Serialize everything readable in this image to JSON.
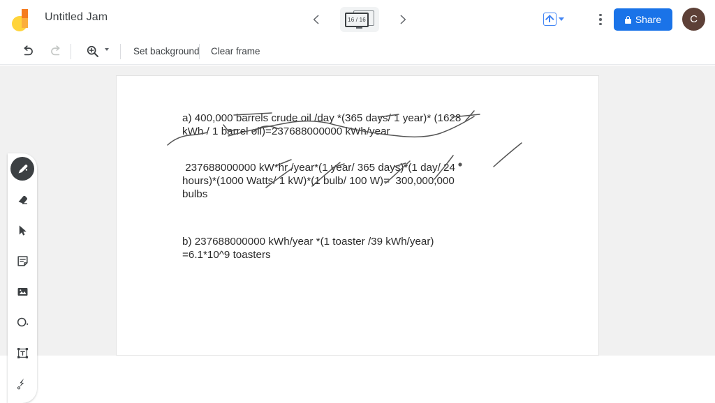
{
  "app": {
    "logo_icon": "jamboard-logo-icon",
    "title": "Untitled Jam"
  },
  "topbar": {
    "prev_frame_icon": "chevron-left-icon",
    "next_frame_icon": "chevron-right-icon",
    "frame_counter": "16 / 16",
    "frame_icon": "frame-stack-icon",
    "export_icon": "export-upload-icon",
    "export_caret_icon": "caret-down-icon",
    "more_icon": "kebab-menu-icon",
    "share_label": "Share",
    "share_lock_icon": "lock-icon",
    "avatar_initial": "C",
    "avatar_color": "#5d4037",
    "share_color": "#1a73e8",
    "accent_blue": "#4285f4"
  },
  "toolbar": {
    "undo_icon": "undo-icon",
    "redo_icon": "redo-icon",
    "zoom_icon": "zoom-in-icon",
    "zoom_caret_icon": "caret-down-icon",
    "set_background_label": "Set background",
    "clear_frame_label": "Clear frame"
  },
  "tools": [
    {
      "name": "pen-tool",
      "icon": "pen-icon",
      "active": true
    },
    {
      "name": "eraser-tool",
      "icon": "eraser-icon",
      "active": false
    },
    {
      "name": "select-tool",
      "icon": "cursor-arrow-icon",
      "active": false
    },
    {
      "name": "sticky-note-tool",
      "icon": "sticky-note-icon",
      "active": false
    },
    {
      "name": "image-tool",
      "icon": "image-icon",
      "active": false
    },
    {
      "name": "shape-tool",
      "icon": "circle-shape-icon",
      "active": false
    },
    {
      "name": "text-box-tool",
      "icon": "text-box-icon",
      "active": false
    },
    {
      "name": "laser-tool",
      "icon": "laser-pointer-icon",
      "active": false
    }
  ],
  "canvas": {
    "background": "#ffffff",
    "workspace_background": "#f1f1f1",
    "paragraphs": [
      "a) 400,000 barrels crude oil /day *(365 days/ 1 year)* (1628 kWh / 1 barrel oil)=237688000000 kWh/year",
      " 237688000000 kW*hr /year*(1 year/ 365 days)*(1 day/ 24 hours)*(1000 Watts/ 1 kW)*(1 bulb/ 100 W)=  300,000,000 bulbs",
      "b) 237688000000 kWh/year *(1 toaster /39 kWh/year)\n=6.1*10^9 toasters"
    ],
    "ink_color": "#555555",
    "ink_annotation": "handwritten-pen-strokes"
  }
}
